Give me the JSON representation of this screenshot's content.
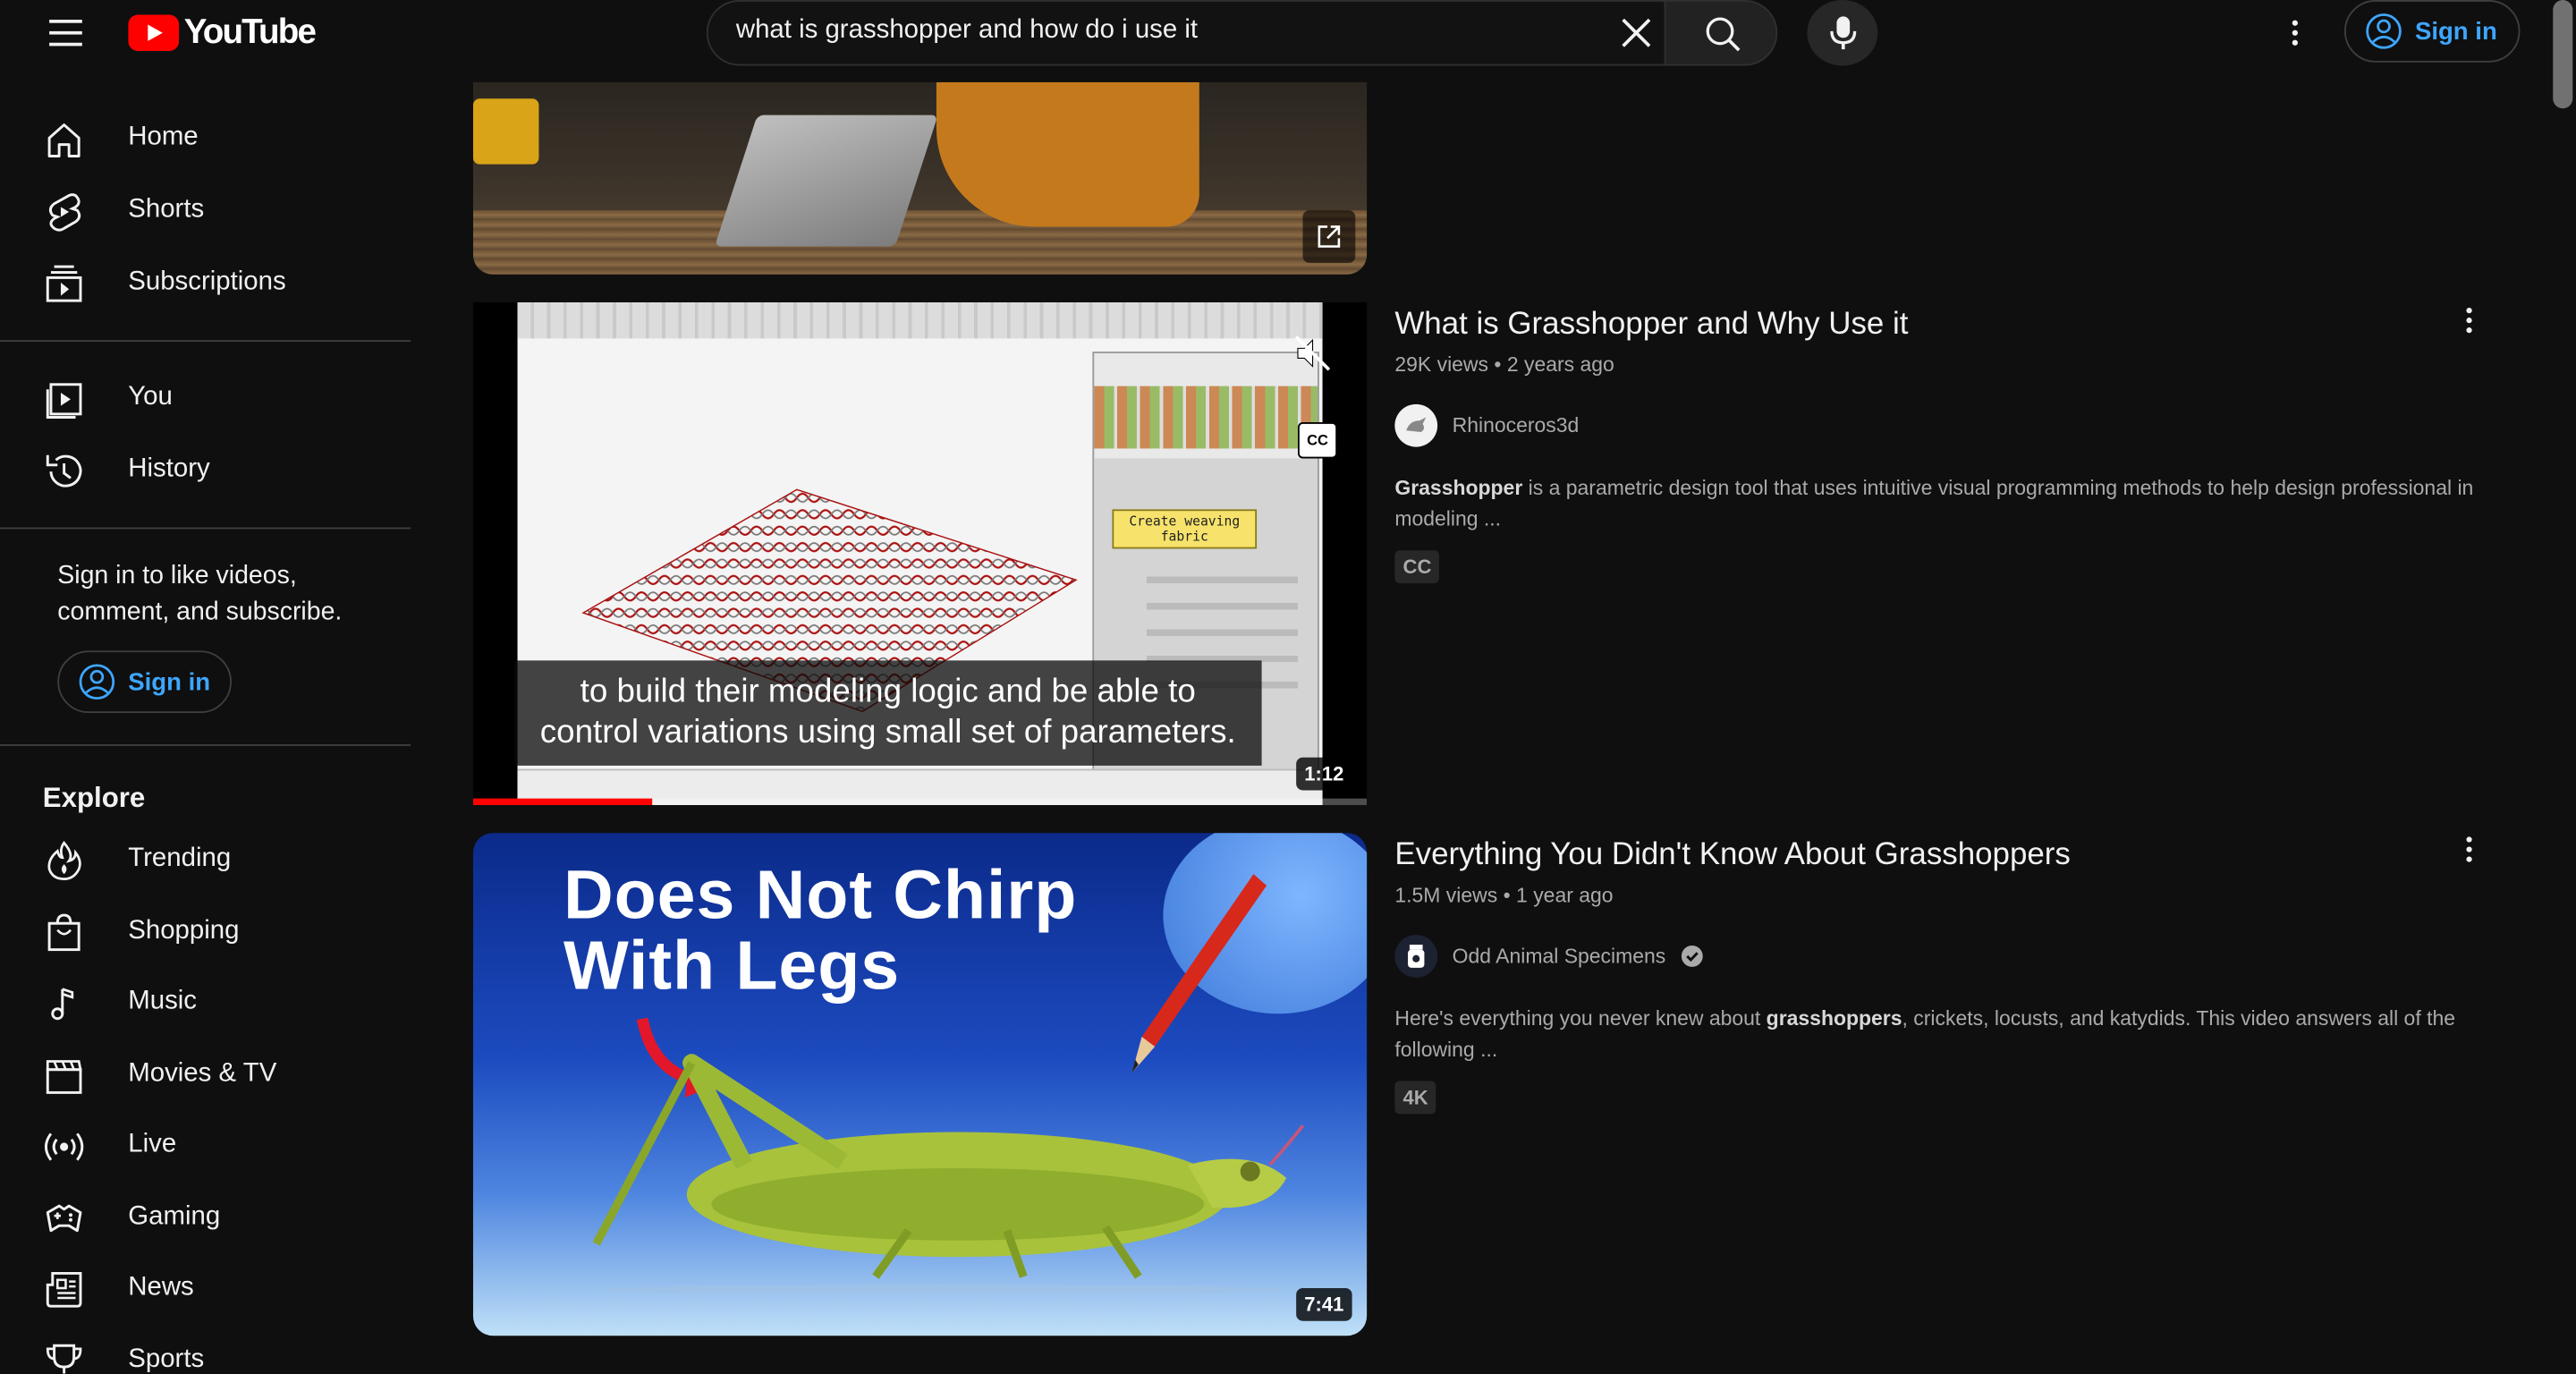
{
  "header": {
    "logo_text": "YouTube",
    "search_value": "what is grasshopper and how do i use it",
    "sign_in_label": "Sign in"
  },
  "sidebar": {
    "main": [
      {
        "label": "Home",
        "icon": "home-icon"
      },
      {
        "label": "Shorts",
        "icon": "shorts-icon"
      },
      {
        "label": "Subscriptions",
        "icon": "subscriptions-icon"
      }
    ],
    "you": [
      {
        "label": "You",
        "icon": "you-icon"
      },
      {
        "label": "History",
        "icon": "history-icon"
      }
    ],
    "signin_prompt": "Sign in to like videos, comment, and subscribe.",
    "signin_label": "Sign in",
    "explore_title": "Explore",
    "explore": [
      {
        "label": "Trending",
        "icon": "trending-icon"
      },
      {
        "label": "Shopping",
        "icon": "shopping-icon"
      },
      {
        "label": "Music",
        "icon": "music-icon"
      },
      {
        "label": "Movies & TV",
        "icon": "movies-icon"
      },
      {
        "label": "Live",
        "icon": "live-icon"
      },
      {
        "label": "Gaming",
        "icon": "gaming-icon"
      },
      {
        "label": "News",
        "icon": "news-icon"
      },
      {
        "label": "Sports",
        "icon": "sports-icon"
      }
    ]
  },
  "results": [
    {
      "title": "What is Grasshopper and Why Use it",
      "views": "29K views",
      "age": "2 years ago",
      "channel": "Rhinoceros3d",
      "desc_bold": "Grasshopper",
      "desc_rest": " is a parametric design tool that uses intuitive visual programming methods to help design professional in modeling ...",
      "badge": "CC",
      "duration": "1:12",
      "caption_line1": "to build their modeling logic and be able to",
      "caption_line2": "control variations using small set of parameters.",
      "note_text": "Create weaving fabric",
      "cc_button": "CC",
      "progress": 0.2
    },
    {
      "title": "Everything You Didn't Know About Grasshoppers",
      "views": "1.5M views",
      "age": "1 year ago",
      "channel": "Odd Animal Specimens",
      "desc_pre": "Here's everything you never knew about ",
      "desc_bold": "grasshoppers",
      "desc_rest": ", crickets, locusts, and katydids. This video answers all of the following ...",
      "badge": "4K",
      "duration": "7:41",
      "thumb_text_line1": "Does Not Chirp",
      "thumb_text_line2": "With Legs"
    }
  ],
  "colors": {
    "background": "#0f0f0f",
    "accent_blue": "#3ea6ff",
    "youtube_red": "#ff0000",
    "progress_red": "#ff0000"
  }
}
